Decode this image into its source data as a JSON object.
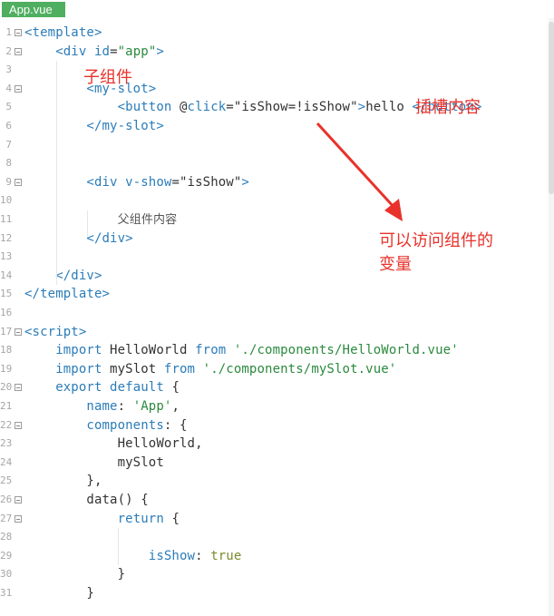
{
  "tab": {
    "label": "App.vue"
  },
  "lines": [
    {
      "n": "1",
      "fold": true,
      "segs": [
        [
          "tag",
          "<template>"
        ]
      ]
    },
    {
      "n": "2",
      "fold": true,
      "segs": [
        [
          "txt",
          "    "
        ],
        [
          "tag",
          "<div "
        ],
        [
          "attr",
          "id"
        ],
        [
          "txt",
          "="
        ],
        [
          "str",
          "\"app\""
        ],
        [
          "tag",
          ">"
        ]
      ]
    },
    {
      "n": "3",
      "fold": false,
      "segs": []
    },
    {
      "n": "4",
      "fold": true,
      "segs": [
        [
          "txt",
          "        "
        ],
        [
          "tag",
          "<my-slot>"
        ]
      ]
    },
    {
      "n": "5",
      "fold": false,
      "segs": [
        [
          "txt",
          "            "
        ],
        [
          "tag",
          "<button "
        ],
        [
          "txt",
          "@"
        ],
        [
          "attr",
          "click"
        ],
        [
          "txt",
          "="
        ],
        [
          "txt",
          "\"isShow=!isShow\""
        ],
        [
          "tag",
          ">"
        ],
        [
          "txt",
          "hello "
        ],
        [
          "tag",
          "</button>"
        ]
      ]
    },
    {
      "n": "6",
      "fold": false,
      "segs": [
        [
          "txt",
          "        "
        ],
        [
          "tag",
          "</my-slot>"
        ]
      ]
    },
    {
      "n": "7",
      "fold": false,
      "segs": []
    },
    {
      "n": "8",
      "fold": false,
      "segs": []
    },
    {
      "n": "9",
      "fold": true,
      "segs": [
        [
          "txt",
          "        "
        ],
        [
          "tag",
          "<div "
        ],
        [
          "attr",
          "v-show"
        ],
        [
          "txt",
          "="
        ],
        [
          "txt",
          "\"isShow\""
        ],
        [
          "tag",
          ">"
        ]
      ]
    },
    {
      "n": "10",
      "fold": false,
      "segs": []
    },
    {
      "n": "11",
      "fold": false,
      "segs": [
        [
          "txt",
          "            "
        ],
        [
          "cn",
          "父组件内容"
        ]
      ]
    },
    {
      "n": "12",
      "fold": false,
      "segs": [
        [
          "txt",
          "        "
        ],
        [
          "tag",
          "</div>"
        ]
      ]
    },
    {
      "n": "13",
      "fold": false,
      "segs": []
    },
    {
      "n": "14",
      "fold": false,
      "segs": [
        [
          "txt",
          "    "
        ],
        [
          "tag",
          "</div>"
        ]
      ]
    },
    {
      "n": "15",
      "fold": false,
      "segs": [
        [
          "tag",
          "</template>"
        ]
      ]
    },
    {
      "n": "16",
      "fold": false,
      "segs": []
    },
    {
      "n": "17",
      "fold": true,
      "segs": [
        [
          "tag",
          "<script>"
        ]
      ]
    },
    {
      "n": "18",
      "fold": false,
      "segs": [
        [
          "txt",
          "    "
        ],
        [
          "kw",
          "import "
        ],
        [
          "txt",
          "HelloWorld "
        ],
        [
          "kw",
          "from "
        ],
        [
          "str",
          "'./components/HelloWorld.vue'"
        ]
      ]
    },
    {
      "n": "19",
      "fold": false,
      "segs": [
        [
          "txt",
          "    "
        ],
        [
          "kw",
          "import "
        ],
        [
          "txt",
          "mySlot "
        ],
        [
          "kw",
          "from "
        ],
        [
          "str",
          "'./components/mySlot.vue'"
        ]
      ]
    },
    {
      "n": "20",
      "fold": true,
      "segs": [
        [
          "txt",
          "    "
        ],
        [
          "kw",
          "export default "
        ],
        [
          "txt",
          "{"
        ]
      ]
    },
    {
      "n": "21",
      "fold": false,
      "segs": [
        [
          "txt",
          "        "
        ],
        [
          "prop",
          "name"
        ],
        [
          "txt",
          ": "
        ],
        [
          "str",
          "'App'"
        ],
        [
          "txt",
          ","
        ]
      ]
    },
    {
      "n": "22",
      "fold": true,
      "segs": [
        [
          "txt",
          "        "
        ],
        [
          "prop",
          "components"
        ],
        [
          "txt",
          ": {"
        ]
      ]
    },
    {
      "n": "23",
      "fold": false,
      "segs": [
        [
          "txt",
          "            HelloWorld,"
        ]
      ]
    },
    {
      "n": "24",
      "fold": false,
      "segs": [
        [
          "txt",
          "            mySlot"
        ]
      ]
    },
    {
      "n": "25",
      "fold": false,
      "segs": [
        [
          "txt",
          "        },"
        ]
      ]
    },
    {
      "n": "26",
      "fold": true,
      "segs": [
        [
          "txt",
          "        data() {"
        ]
      ]
    },
    {
      "n": "27",
      "fold": true,
      "segs": [
        [
          "txt",
          "            "
        ],
        [
          "kw",
          "return "
        ],
        [
          "txt",
          "{"
        ]
      ]
    },
    {
      "n": "28",
      "fold": false,
      "segs": []
    },
    {
      "n": "29",
      "fold": false,
      "segs": [
        [
          "txt",
          "                "
        ],
        [
          "prop",
          "isShow"
        ],
        [
          "txt",
          ": "
        ],
        [
          "val",
          "true"
        ]
      ]
    },
    {
      "n": "30",
      "fold": false,
      "segs": [
        [
          "txt",
          "            }"
        ]
      ]
    },
    {
      "n": "31",
      "fold": false,
      "segs": [
        [
          "txt",
          "        }"
        ]
      ]
    }
  ],
  "annotations": {
    "child_component": "子组件",
    "slot_content": "插槽内容",
    "access_line1": "可以访问组件的",
    "access_line2": "变量"
  },
  "colors": {
    "annotation": "#e8322b",
    "tab": "#4fae5f"
  }
}
